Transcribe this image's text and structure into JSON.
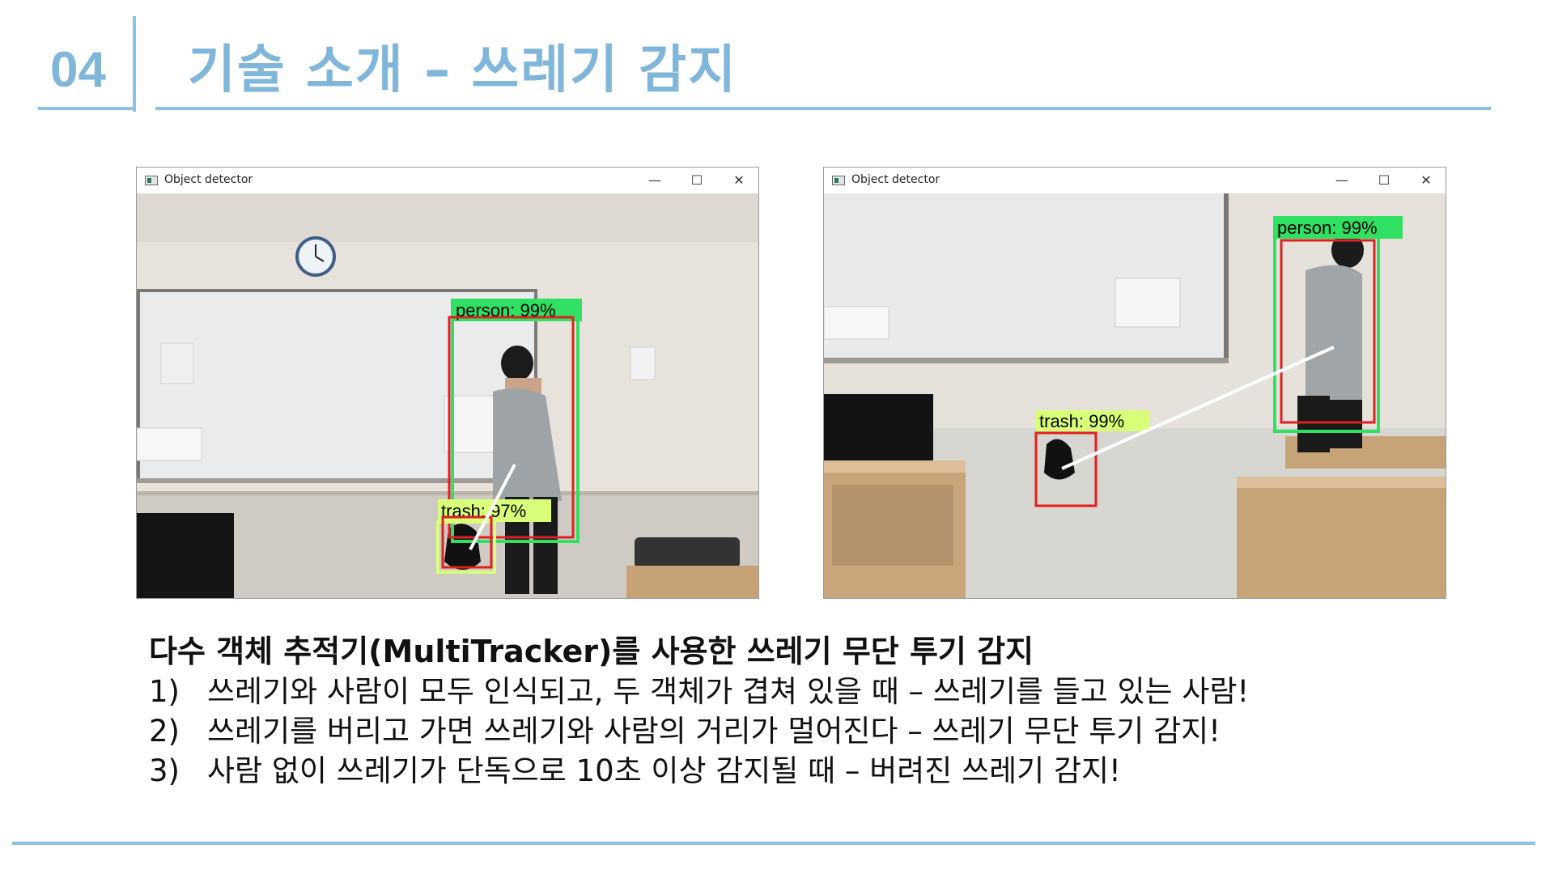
{
  "header": {
    "slide_number": "04",
    "title": "기술 소개 – 쓰레기 감지"
  },
  "windows": [
    {
      "title": "Object detector",
      "controls": {
        "minimize": "—",
        "maximize": "☐",
        "close": "✕"
      },
      "detections": [
        {
          "label": "person: 99%",
          "class": "person",
          "confidence": 99
        },
        {
          "label": "trash: 97%",
          "class": "trash",
          "confidence": 97
        }
      ]
    },
    {
      "title": "Object detector",
      "controls": {
        "minimize": "—",
        "maximize": "☐",
        "close": "✕"
      },
      "detections": [
        {
          "label": "person: 99%",
          "class": "person",
          "confidence": 99
        },
        {
          "label": "trash: 99%",
          "class": "trash",
          "confidence": 99
        }
      ]
    }
  ],
  "caption": {
    "heading": "다수 객체 추적기(MultiTracker)를 사용한 쓰레기 무단 투기 감지",
    "items": [
      {
        "num": "1)",
        "text": "쓰레기와 사람이 모두 인식되고, 두 객체가 겹쳐 있을 때 – 쓰레기를 들고 있는 사람!"
      },
      {
        "num": "2)",
        "text": "쓰레기를 버리고 가면 쓰레기와 사람의 거리가 멀어진다 – 쓰레기 무단 투기 감지!"
      },
      {
        "num": "3)",
        "text": "사람 없이 쓰레기가 단독으로 10초 이상 감지될 때 – 버려진 쓰레기 감지!"
      }
    ]
  },
  "colors": {
    "accent": "#7fb6d9",
    "person_box": "#2fe063",
    "trash_label_bg": "#d8ff7a",
    "tracker_box": "#e02020",
    "tracker_line": "#ffffff"
  }
}
